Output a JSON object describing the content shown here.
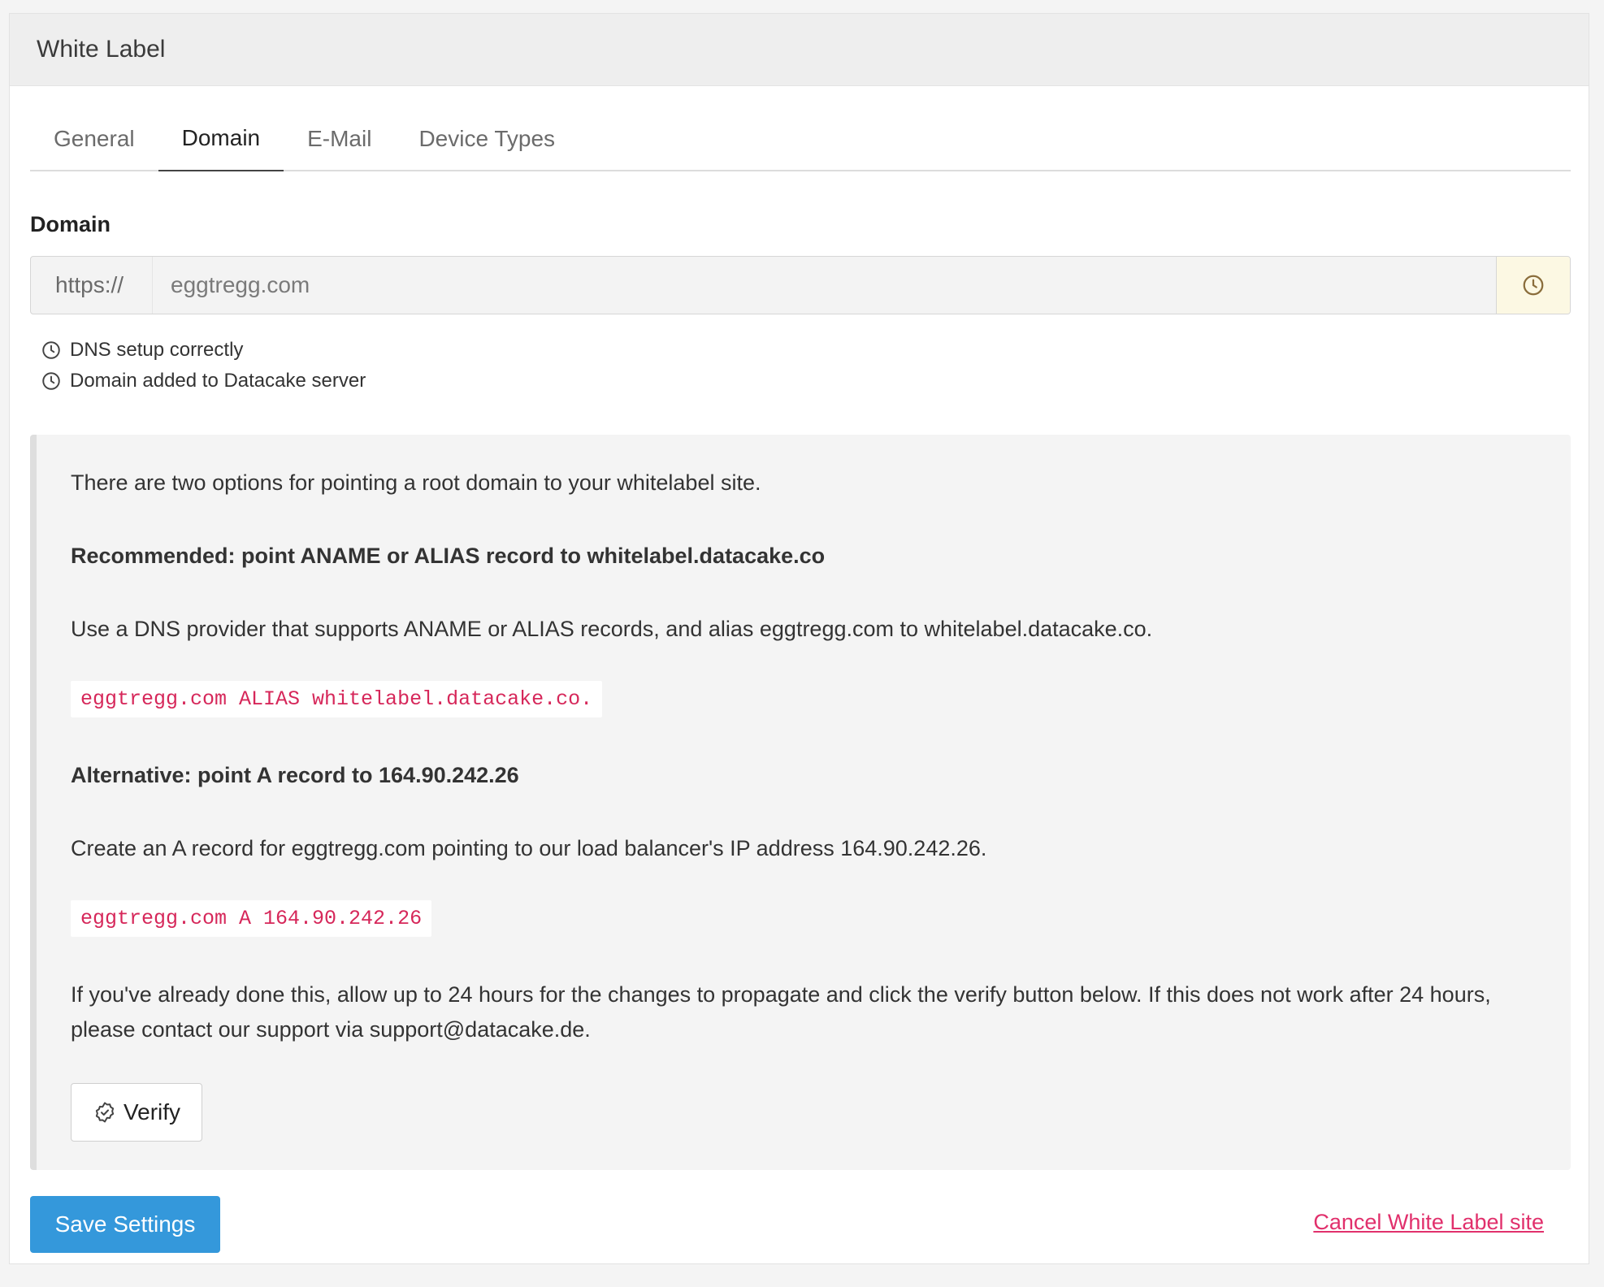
{
  "panel": {
    "title": "White Label"
  },
  "tabs": [
    {
      "label": "General",
      "active": false
    },
    {
      "label": "Domain",
      "active": true
    },
    {
      "label": "E-Mail",
      "active": false
    },
    {
      "label": "Device Types",
      "active": false
    }
  ],
  "domain": {
    "label": "Domain",
    "prefix": "https://",
    "value": "eggtregg.com",
    "status_icon": "clock-icon",
    "status_color": "#8a6d3b"
  },
  "checks": [
    {
      "icon": "clock-icon",
      "label": "DNS setup correctly"
    },
    {
      "icon": "clock-icon",
      "label": "Domain added to Datacake server"
    }
  ],
  "instructions": {
    "intro": "There are two options for pointing a root domain to your whitelabel site.",
    "recommended_heading": "Recommended: point ANAME or ALIAS record to whitelabel.datacake.co",
    "recommended_text": "Use a DNS provider that supports ANAME or ALIAS records, and alias eggtregg.com to whitelabel.datacake.co.",
    "recommended_code": "eggtregg.com ALIAS whitelabel.datacake.co.",
    "alternative_heading": "Alternative: point A record to 164.90.242.26",
    "alternative_text": "Create an A record for eggtregg.com pointing to our load balancer's IP address 164.90.242.26.",
    "alternative_code": "eggtregg.com A 164.90.242.26",
    "footer_text": "If you've already done this, allow up to 24 hours for the changes to propagate and click the verify button below. If this does not work after 24 hours, please contact our support via support@datacake.de.",
    "verify_label": "Verify",
    "verify_icon": "badge-check-icon"
  },
  "actions": {
    "save_label": "Save Settings",
    "cancel_label": "Cancel White Label site"
  },
  "colors": {
    "primary": "#3498db",
    "danger": "#e1306c",
    "code": "#d6275a",
    "warning_bg": "#fcf8e3"
  }
}
